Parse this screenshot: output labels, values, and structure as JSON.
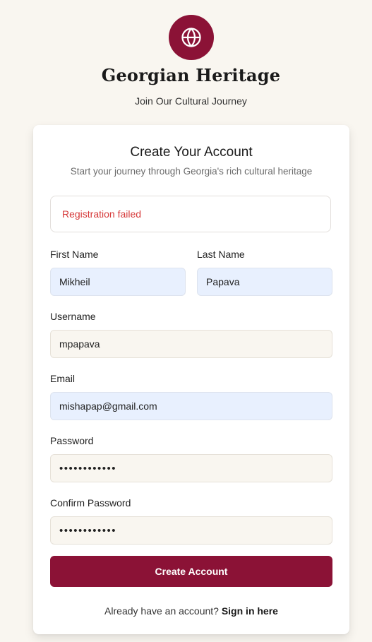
{
  "brand": {
    "icon": "globe-icon",
    "title": "Georgian Heritage",
    "subtitle": "Join Our Cultural Journey",
    "accent_color": "#8b1236"
  },
  "card": {
    "title": "Create Your Account",
    "subtitle": "Start your journey through Georgia's rich cultural heritage"
  },
  "alert": {
    "message": "Registration failed",
    "color": "#d63a3a"
  },
  "form": {
    "first_name": {
      "label": "First Name",
      "value": "Mikheil"
    },
    "last_name": {
      "label": "Last Name",
      "value": "Papava"
    },
    "username": {
      "label": "Username",
      "value": "mpapava"
    },
    "email": {
      "label": "Email",
      "value": "mishapap@gmail.com"
    },
    "password": {
      "label": "Password",
      "value": "••••••••••••"
    },
    "confirm_password": {
      "label": "Confirm Password",
      "value": "••••••••••••"
    }
  },
  "submit": {
    "label": "Create Account"
  },
  "footer": {
    "prompt": "Already have an account?",
    "link": "Sign in here"
  }
}
